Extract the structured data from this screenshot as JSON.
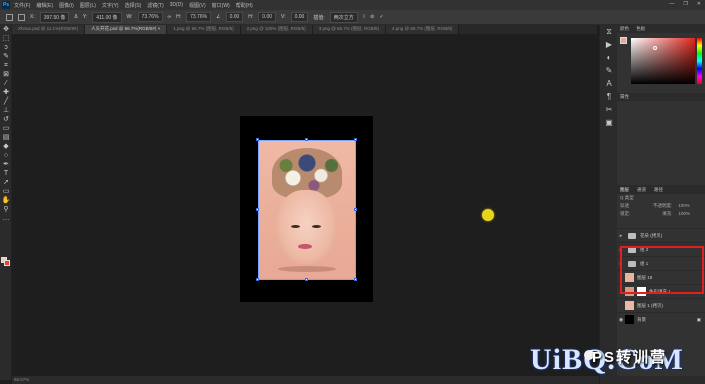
{
  "app": {
    "logo": "Ps"
  },
  "menu": [
    "文件(F)",
    "编辑(E)",
    "图像(I)",
    "图层(L)",
    "文字(Y)",
    "选择(S)",
    "滤镜(T)",
    "3D(D)",
    "视图(V)",
    "窗口(W)",
    "帮助(H)"
  ],
  "window_controls": [
    "—",
    "❐",
    "✕"
  ],
  "options_bar": {
    "x_value": "397.50 像",
    "y_value": "411.00 像",
    "w_value": "73.76%",
    "h_value": "73.76%",
    "angle_value": "0.00",
    "h_skew": "0.00",
    "v_skew": "0.00",
    "interp": "两次立方"
  },
  "tabs": [
    {
      "label": "Xhnun.psd @ 11.1%(RGB/8#)",
      "active": false
    },
    {
      "label": "人头开花.psd @ 66.7%(RGB/8#) ×",
      "active": true
    },
    {
      "label": "1.png @ 66.7% (图层, RGB/8)",
      "active": false
    },
    {
      "label": "2.png @ 100% (图层, RGB/8)",
      "active": false
    },
    {
      "label": "3.png @ 66.7% (图层, RGB/8)",
      "active": false
    },
    {
      "label": "4.png @ 66.7% (图层, RGB/8)",
      "active": false
    }
  ],
  "status": {
    "zoom": "66.67%"
  },
  "panels": {
    "color_tabs": [
      "颜色",
      "色板"
    ],
    "properties_tab": "属性",
    "layers_tabs": [
      "图层",
      "通道",
      "路径"
    ],
    "search_label": "Q 类型",
    "blend_mode": "穿透",
    "opacity_label": "不透明度:",
    "opacity_value": "100%",
    "lock_label": "锁定:",
    "fill_label": "填充:",
    "fill_value": "100%"
  },
  "layers": [
    {
      "name": "花朵 (拷贝)",
      "type": "group"
    },
    {
      "name": "组 2",
      "type": "group"
    },
    {
      "name": "组 1",
      "type": "group"
    },
    {
      "name": "图层 19",
      "type": "layer"
    },
    {
      "name": "色彩填充 1",
      "type": "fill"
    },
    {
      "name": "图层 1 (拷贝)",
      "type": "layer"
    },
    {
      "name": "背景",
      "type": "background"
    }
  ],
  "watermark": {
    "text_ps": "PS转训营",
    "text_site": "UiBQ.CoM"
  },
  "colors": {
    "selection": "#7aa6ff",
    "highlight_box": "#e02020",
    "cursor": "#e7d61a",
    "bg_swatch": "#e0473a"
  }
}
